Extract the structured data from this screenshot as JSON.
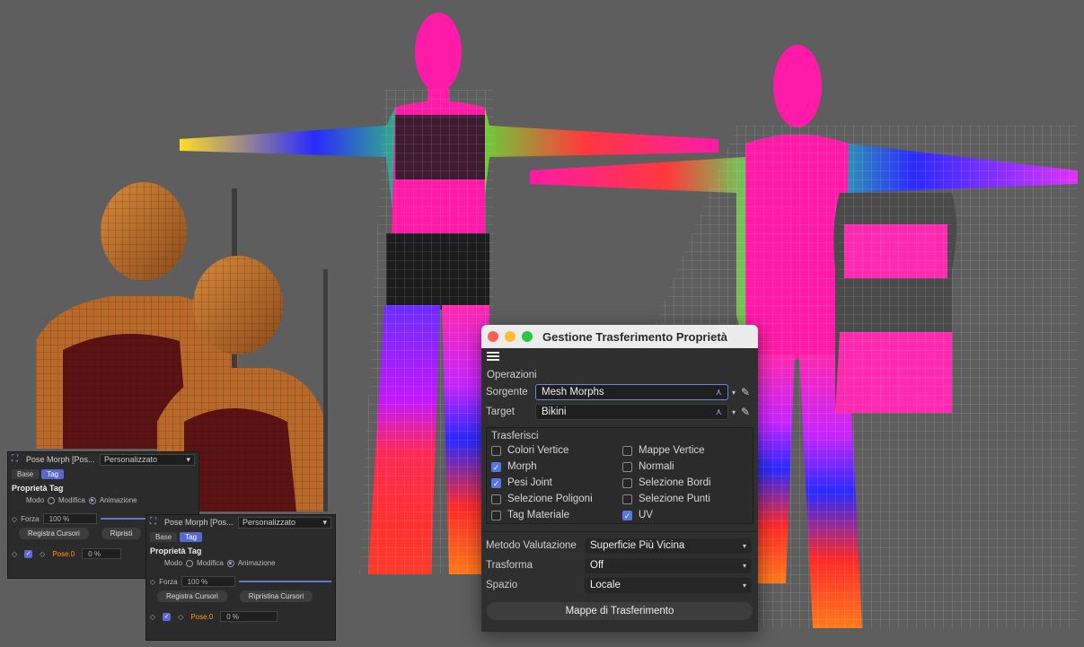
{
  "dialog": {
    "title": "Gestione Trasferimento Proprietà",
    "section_label": "Operazioni",
    "source_label": "Sorgente",
    "source_value": "Mesh Morphs",
    "target_label": "Target",
    "target_value": "Bikini",
    "transfer_group_title": "Trasferisci",
    "transfer_options": [
      {
        "label": "Colori Vertice",
        "checked": false
      },
      {
        "label": "Mappe Vertice",
        "checked": false
      },
      {
        "label": "Morph",
        "checked": true
      },
      {
        "label": "Normali",
        "checked": false
      },
      {
        "label": "Pesi Joint",
        "checked": true
      },
      {
        "label": "Selezione Bordi",
        "checked": false
      },
      {
        "label": "Selezione Poligoni",
        "checked": false
      },
      {
        "label": "Selezione Punti",
        "checked": false
      },
      {
        "label": "Tag Materiale",
        "checked": false
      },
      {
        "label": "UV",
        "checked": true
      }
    ],
    "method_label": "Metodo Valutazione",
    "method_value": "Superficie Più Vicina",
    "transform_label": "Trasforma",
    "transform_value": "Off",
    "space_label": "Spazio",
    "space_value": "Locale",
    "transfer_maps_button": "Mappe di Trasferimento"
  },
  "pose_panel_1": {
    "title": "Pose Morph [Pos...",
    "preset": "Personalizzato",
    "tab_base": "Base",
    "tab_tag": "Tag",
    "section": "Proprietà Tag",
    "mode_label": "Modo",
    "mode_edit": "Modifica",
    "mode_anim": "Animazione",
    "strength_label": "Forza",
    "strength_value": "100 %",
    "record_button": "Registra Cursori",
    "reset_button": "Ripristi",
    "pose_name": "Pose.0",
    "pose_value": "0 %"
  },
  "pose_panel_2": {
    "title": "Pose Morph [Pos...",
    "preset": "Personalizzato",
    "tab_base": "Base",
    "tab_tag": "Tag",
    "section": "Proprietà Tag",
    "mode_label": "Modo",
    "mode_edit": "Modifica",
    "mode_anim": "Animazione",
    "strength_label": "Forza",
    "strength_value": "100 %",
    "record_button": "Registra Cursori",
    "reset_button": "Ripristina Cursori",
    "pose_name": "Pose.0",
    "pose_value": "0 %"
  },
  "colors": {
    "window_bg": "#2f2f2f",
    "accent": "#5677de",
    "viewport_bg": "#5e5e5e"
  }
}
